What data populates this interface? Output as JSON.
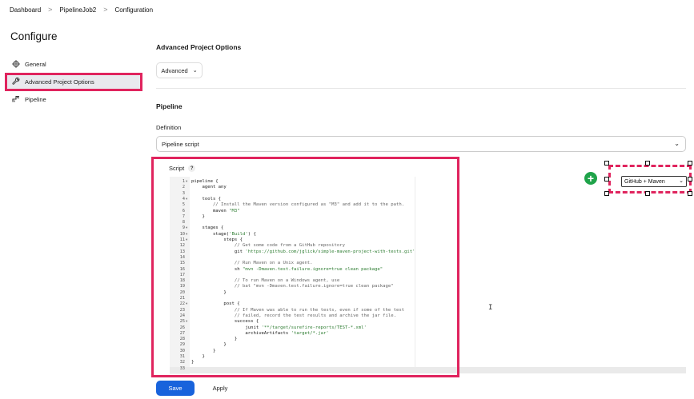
{
  "breadcrumb": {
    "items": [
      "Dashboard",
      "PipelineJob2",
      "Configuration"
    ],
    "separator": ">"
  },
  "sidebar": {
    "title": "Configure",
    "items": [
      {
        "label": "General",
        "icon": "gear-icon"
      },
      {
        "label": "Advanced Project Options",
        "icon": "wrench-icon"
      },
      {
        "label": "Pipeline",
        "icon": "pipeline-icon"
      }
    ],
    "active_index": 1
  },
  "advanced": {
    "title": "Advanced Project Options",
    "button_label": "Advanced"
  },
  "pipeline": {
    "title": "Pipeline",
    "definition_label": "Definition",
    "definition_value": "Pipeline script",
    "script_label": "Script",
    "help_label": "?",
    "sample_select_value": "GitHub + Maven",
    "add_label": "+"
  },
  "script_lines": [
    {
      "n": "1",
      "fold": "▾",
      "text": "pipeline {"
    },
    {
      "n": "2",
      "fold": "",
      "text": "    agent any"
    },
    {
      "n": "3",
      "fold": "",
      "text": ""
    },
    {
      "n": "4",
      "fold": "▾",
      "text": "    tools {"
    },
    {
      "n": "5",
      "fold": "",
      "text": "        // Install the Maven version configured as \"M3\" and add it to the path."
    },
    {
      "n": "6",
      "fold": "",
      "text": "        maven \"M3\""
    },
    {
      "n": "7",
      "fold": "",
      "text": "    }"
    },
    {
      "n": "8",
      "fold": "",
      "text": ""
    },
    {
      "n": "9",
      "fold": "▾",
      "text": "    stages {"
    },
    {
      "n": "10",
      "fold": "▾",
      "text": "        stage('Build') {"
    },
    {
      "n": "11",
      "fold": "▾",
      "text": "            steps {"
    },
    {
      "n": "12",
      "fold": "",
      "text": "                // Get some code from a GitHub repository"
    },
    {
      "n": "13",
      "fold": "",
      "text": "                git 'https://github.com/jglick/simple-maven-project-with-tests.git'"
    },
    {
      "n": "14",
      "fold": "",
      "text": ""
    },
    {
      "n": "15",
      "fold": "",
      "text": "                // Run Maven on a Unix agent."
    },
    {
      "n": "16",
      "fold": "",
      "text": "                sh \"mvn -Dmaven.test.failure.ignore=true clean package\""
    },
    {
      "n": "17",
      "fold": "",
      "text": ""
    },
    {
      "n": "18",
      "fold": "",
      "text": "                // To run Maven on a Windows agent, use"
    },
    {
      "n": "19",
      "fold": "",
      "text": "                // bat \"mvn -Dmaven.test.failure.ignore=true clean package\""
    },
    {
      "n": "20",
      "fold": "",
      "text": "            }"
    },
    {
      "n": "21",
      "fold": "",
      "text": ""
    },
    {
      "n": "22",
      "fold": "▾",
      "text": "            post {"
    },
    {
      "n": "23",
      "fold": "",
      "text": "                // If Maven was able to run the tests, even if some of the test"
    },
    {
      "n": "24",
      "fold": "",
      "text": "                // failed, record the test results and archive the jar file."
    },
    {
      "n": "25",
      "fold": "▾",
      "text": "                success {"
    },
    {
      "n": "26",
      "fold": "",
      "text": "                    junit '**/target/surefire-reports/TEST-*.xml'"
    },
    {
      "n": "27",
      "fold": "",
      "text": "                    archiveArtifacts 'target/*.jar'"
    },
    {
      "n": "28",
      "fold": "",
      "text": "                }"
    },
    {
      "n": "29",
      "fold": "",
      "text": "            }"
    },
    {
      "n": "30",
      "fold": "",
      "text": "        }"
    },
    {
      "n": "31",
      "fold": "",
      "text": "    }"
    },
    {
      "n": "32",
      "fold": "",
      "text": "}"
    },
    {
      "n": "33",
      "fold": "",
      "text": ""
    }
  ],
  "actions": {
    "save_label": "Save",
    "apply_label": "Apply"
  },
  "colors": {
    "highlight": "#e0245e",
    "primary": "#1863dc",
    "add": "#1fa34a"
  }
}
